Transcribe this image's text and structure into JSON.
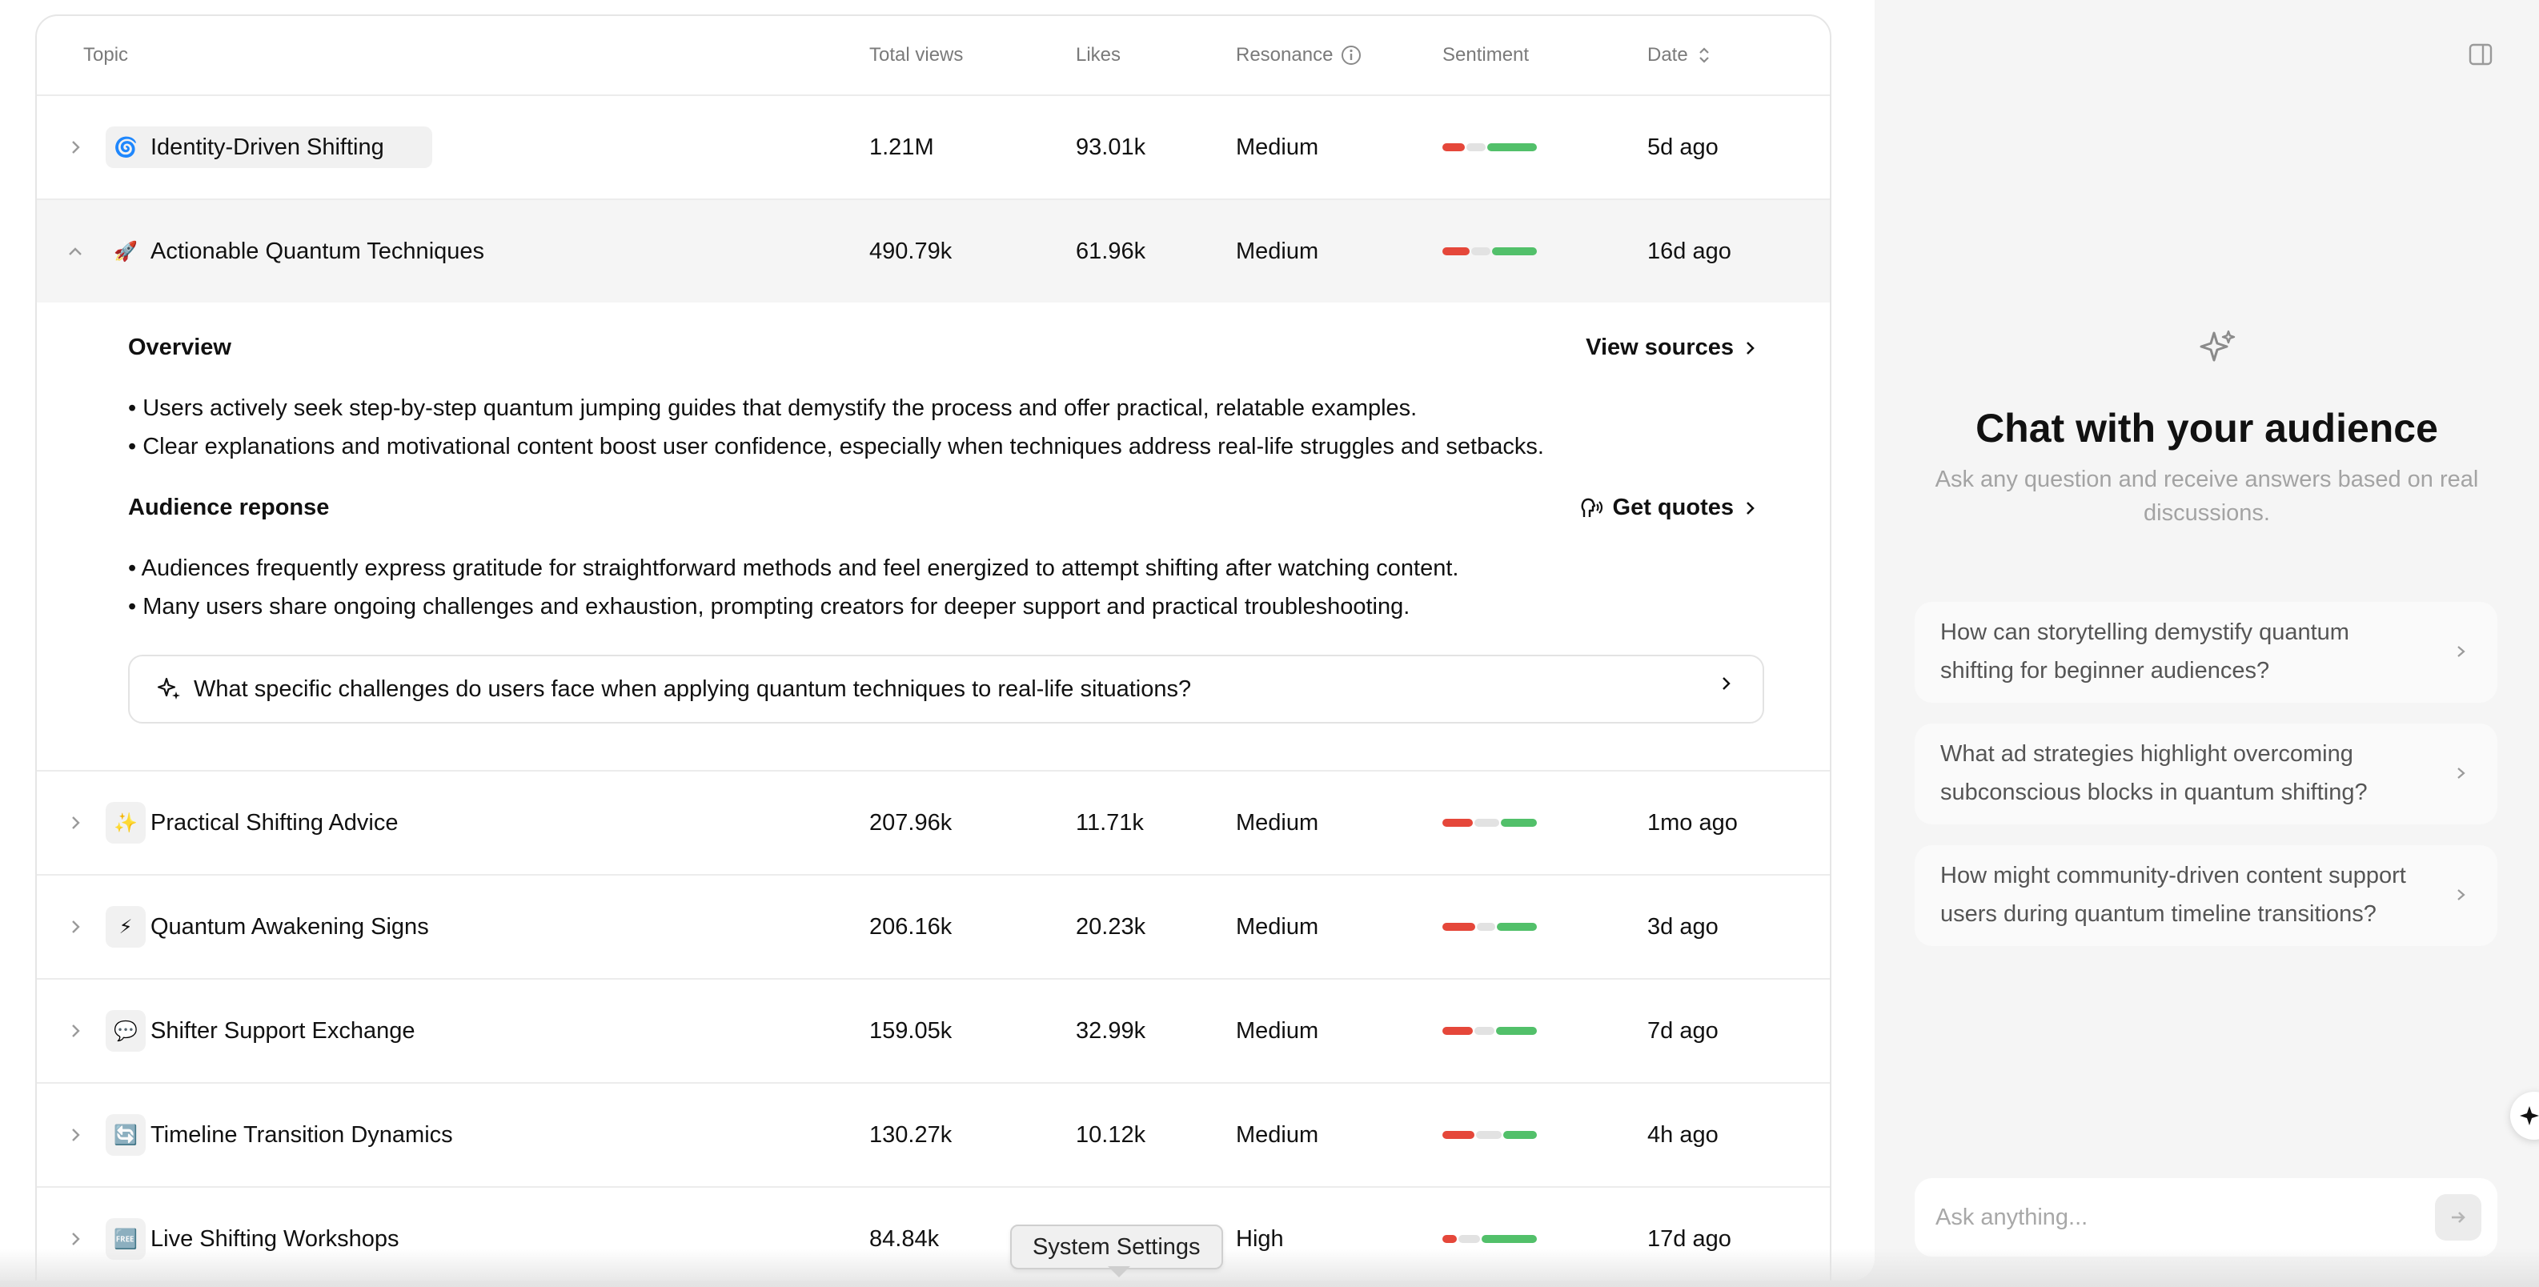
{
  "table": {
    "headers": {
      "topic": "Topic",
      "views": "Total views",
      "likes": "Likes",
      "resonance": "Resonance",
      "sentiment": "Sentiment",
      "date": "Date"
    },
    "rows": [
      {
        "emoji": "🌀",
        "topic": "Identity-Driven Shifting",
        "views": "1.21M",
        "likes": "93.01k",
        "resonance": "Medium",
        "sentiment": {
          "negative": 0.25,
          "neutral": 0.22,
          "positive": 0.53
        },
        "date": "5d ago"
      },
      {
        "emoji": "🚀",
        "topic": "Actionable Quantum Techniques",
        "views": "490.79k",
        "likes": "61.96k",
        "resonance": "Medium",
        "sentiment": {
          "negative": 0.3,
          "neutral": 0.22,
          "positive": 0.48
        },
        "date": "16d ago"
      },
      {
        "emoji": "✨",
        "topic": "Practical Shifting Advice",
        "views": "207.96k",
        "likes": "11.71k",
        "resonance": "Medium",
        "sentiment": {
          "negative": 0.33,
          "neutral": 0.28,
          "positive": 0.39
        },
        "date": "1mo ago"
      },
      {
        "emoji": "⚡",
        "topic": "Quantum Awakening Signs",
        "views": "206.16k",
        "likes": "20.23k",
        "resonance": "Medium",
        "sentiment": {
          "negative": 0.36,
          "neutral": 0.21,
          "positive": 0.43
        },
        "date": "3d ago"
      },
      {
        "emoji": "💬",
        "topic": "Shifter Support Exchange",
        "views": "159.05k",
        "likes": "32.99k",
        "resonance": "Medium",
        "sentiment": {
          "negative": 0.33,
          "neutral": 0.23,
          "positive": 0.44
        },
        "date": "7d ago"
      },
      {
        "emoji": "🔄",
        "topic": "Timeline Transition Dynamics",
        "views": "130.27k",
        "likes": "10.12k",
        "resonance": "Medium",
        "sentiment": {
          "negative": 0.35,
          "neutral": 0.28,
          "positive": 0.37
        },
        "date": "4h ago"
      },
      {
        "emoji": "🆓",
        "topic": "Live Shifting Workshops",
        "views": "84.84k",
        "likes": "",
        "resonance": "High",
        "sentiment": {
          "negative": 0.17,
          "neutral": 0.24,
          "positive": 0.59
        },
        "date": "17d ago"
      }
    ],
    "expanded": {
      "overview_heading": "Overview",
      "view_sources": "View sources",
      "overview_bullets": [
        "• Users actively seek step-by-step quantum jumping guides that demystify the process and offer practical, relatable examples.",
        "• Clear explanations and motivational content boost user confidence, especially when techniques address real-life struggles and setbacks."
      ],
      "audience_heading": "Audience reponse",
      "get_quotes": "Get quotes",
      "audience_bullets": [
        "• Audiences frequently express gratitude for straightforward methods and feel energized to attempt shifting after watching content.",
        "• Many users share ongoing challenges and exhaustion, prompting creators for deeper support and practical troubleshooting."
      ],
      "suggested_question": "What specific challenges do users face when applying quantum techniques to real-life situations?"
    }
  },
  "tooltip": "System Settings",
  "chat": {
    "title": "Chat with your audience",
    "subtitle": "Ask any question and receive answers based on real discussions.",
    "suggestions": [
      "How can storytelling demystify quantum shifting for beginner audiences?",
      "What ad strategies highlight overcoming subconscious blocks in quantum shifting?",
      "How might community-driven content support users during quantum timeline transitions?"
    ],
    "input_placeholder": "Ask anything..."
  },
  "colors": {
    "negative": "#e5473a",
    "neutral": "#e2e2e2",
    "positive": "#52c06a",
    "muted_text": "#a3a3a3"
  }
}
